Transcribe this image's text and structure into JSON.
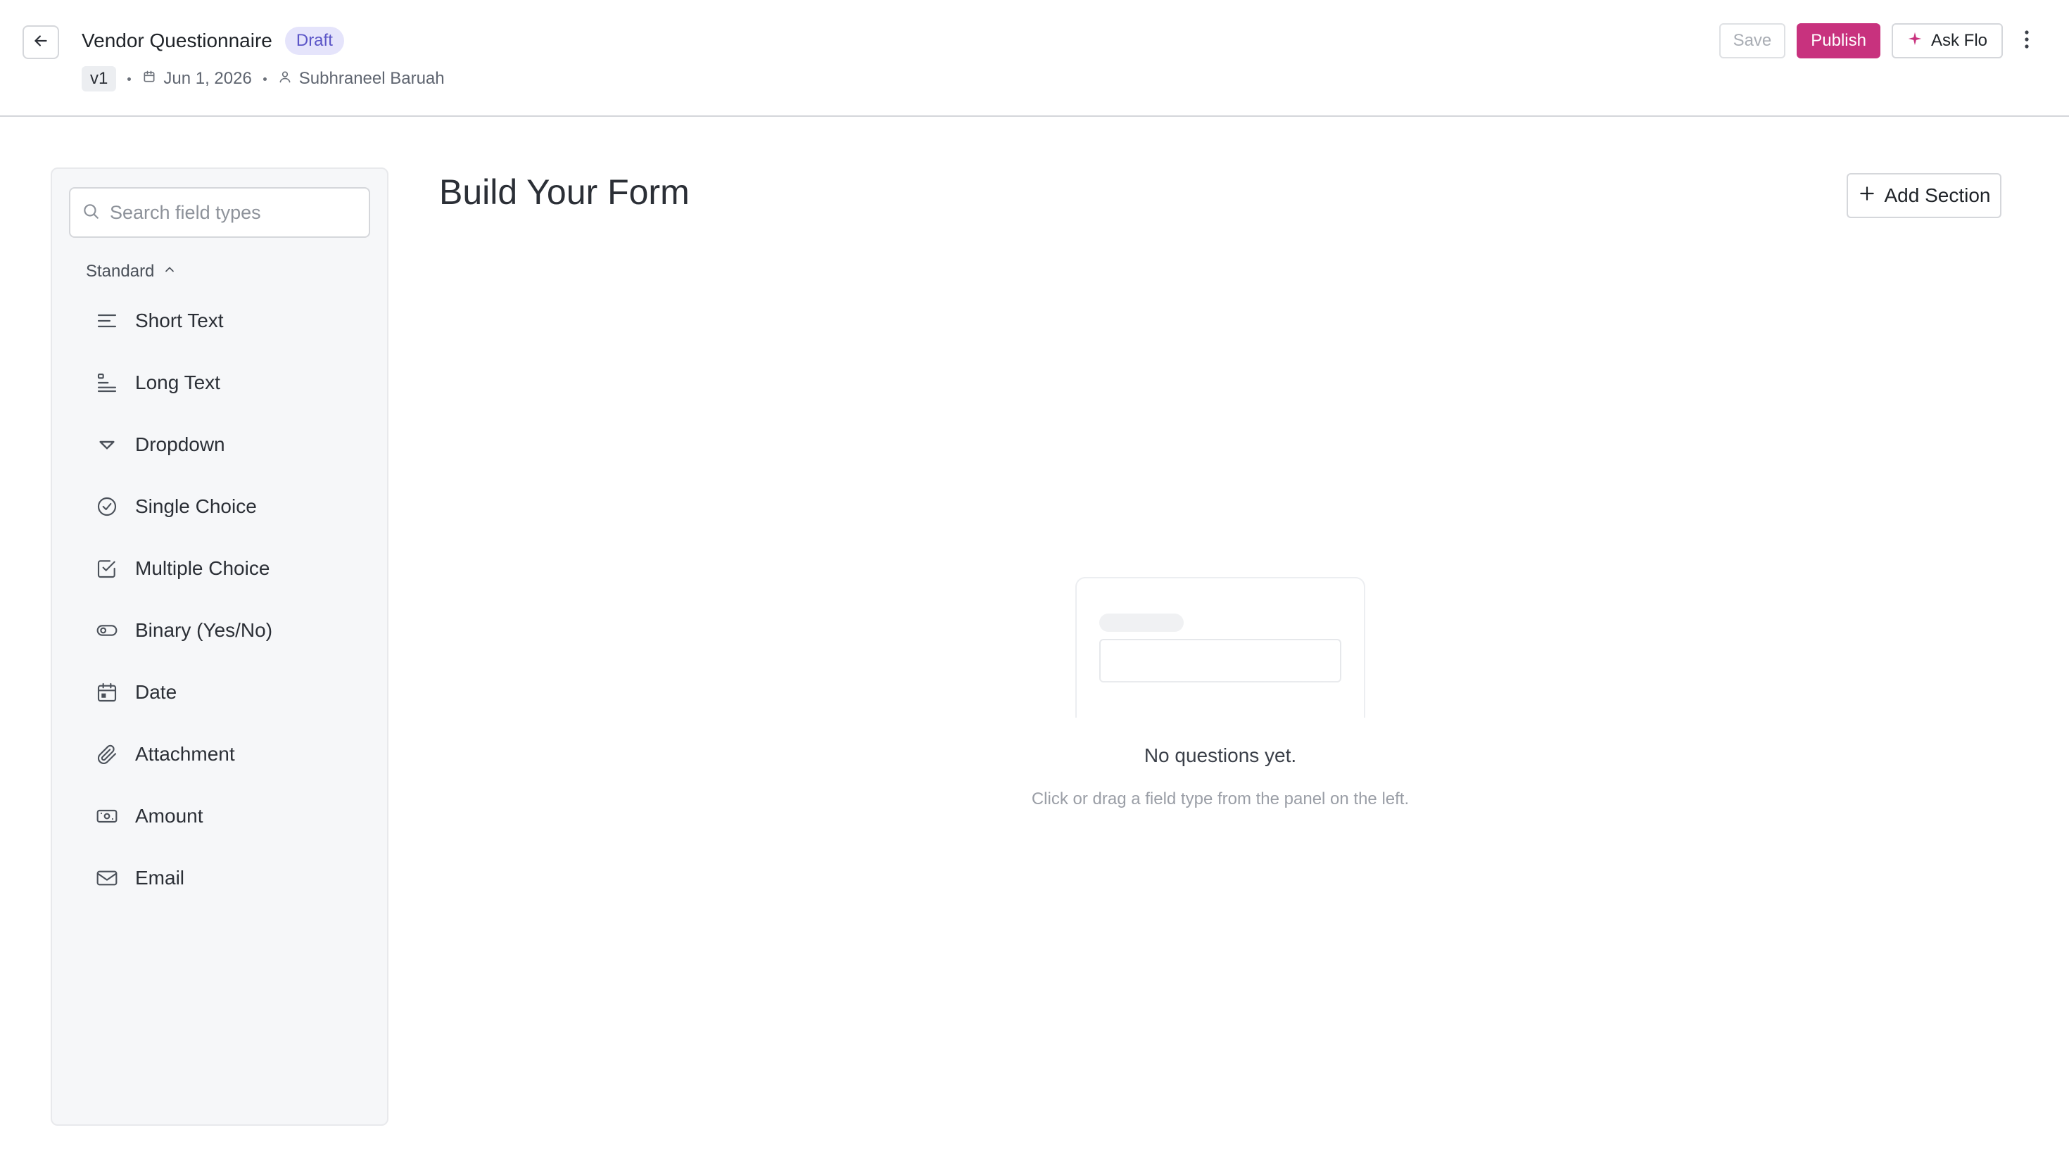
{
  "header": {
    "title": "Vendor Questionnaire",
    "status_badge": "Draft",
    "version": "v1",
    "date": "Jun 1, 2026",
    "author": "Subhraneel Baruah",
    "save_label": "Save",
    "publish_label": "Publish",
    "ask_flo_label": "Ask Flo"
  },
  "sidebar": {
    "search_placeholder": "Search field types",
    "group_label": "Standard",
    "field_types": [
      {
        "label": "Short Text",
        "icon": "short-text-icon"
      },
      {
        "label": "Long Text",
        "icon": "long-text-icon"
      },
      {
        "label": "Dropdown",
        "icon": "dropdown-icon"
      },
      {
        "label": "Single Choice",
        "icon": "single-choice-icon"
      },
      {
        "label": "Multiple Choice",
        "icon": "multiple-choice-icon"
      },
      {
        "label": "Binary (Yes/No)",
        "icon": "toggle-icon"
      },
      {
        "label": "Date",
        "icon": "calendar-icon"
      },
      {
        "label": "Attachment",
        "icon": "paperclip-icon"
      },
      {
        "label": "Amount",
        "icon": "banknote-icon"
      },
      {
        "label": "Email",
        "icon": "mail-icon"
      }
    ]
  },
  "main": {
    "title": "Build Your Form",
    "add_section_label": "Add Section",
    "empty_title": "No questions yet.",
    "empty_subtitle": "Click or drag a field type from the panel on the left."
  },
  "colors": {
    "accent": "#c8327e",
    "badge_bg": "#e5e4fb",
    "badge_text": "#5b55c7",
    "sidebar_bg": "#f6f7f9"
  }
}
